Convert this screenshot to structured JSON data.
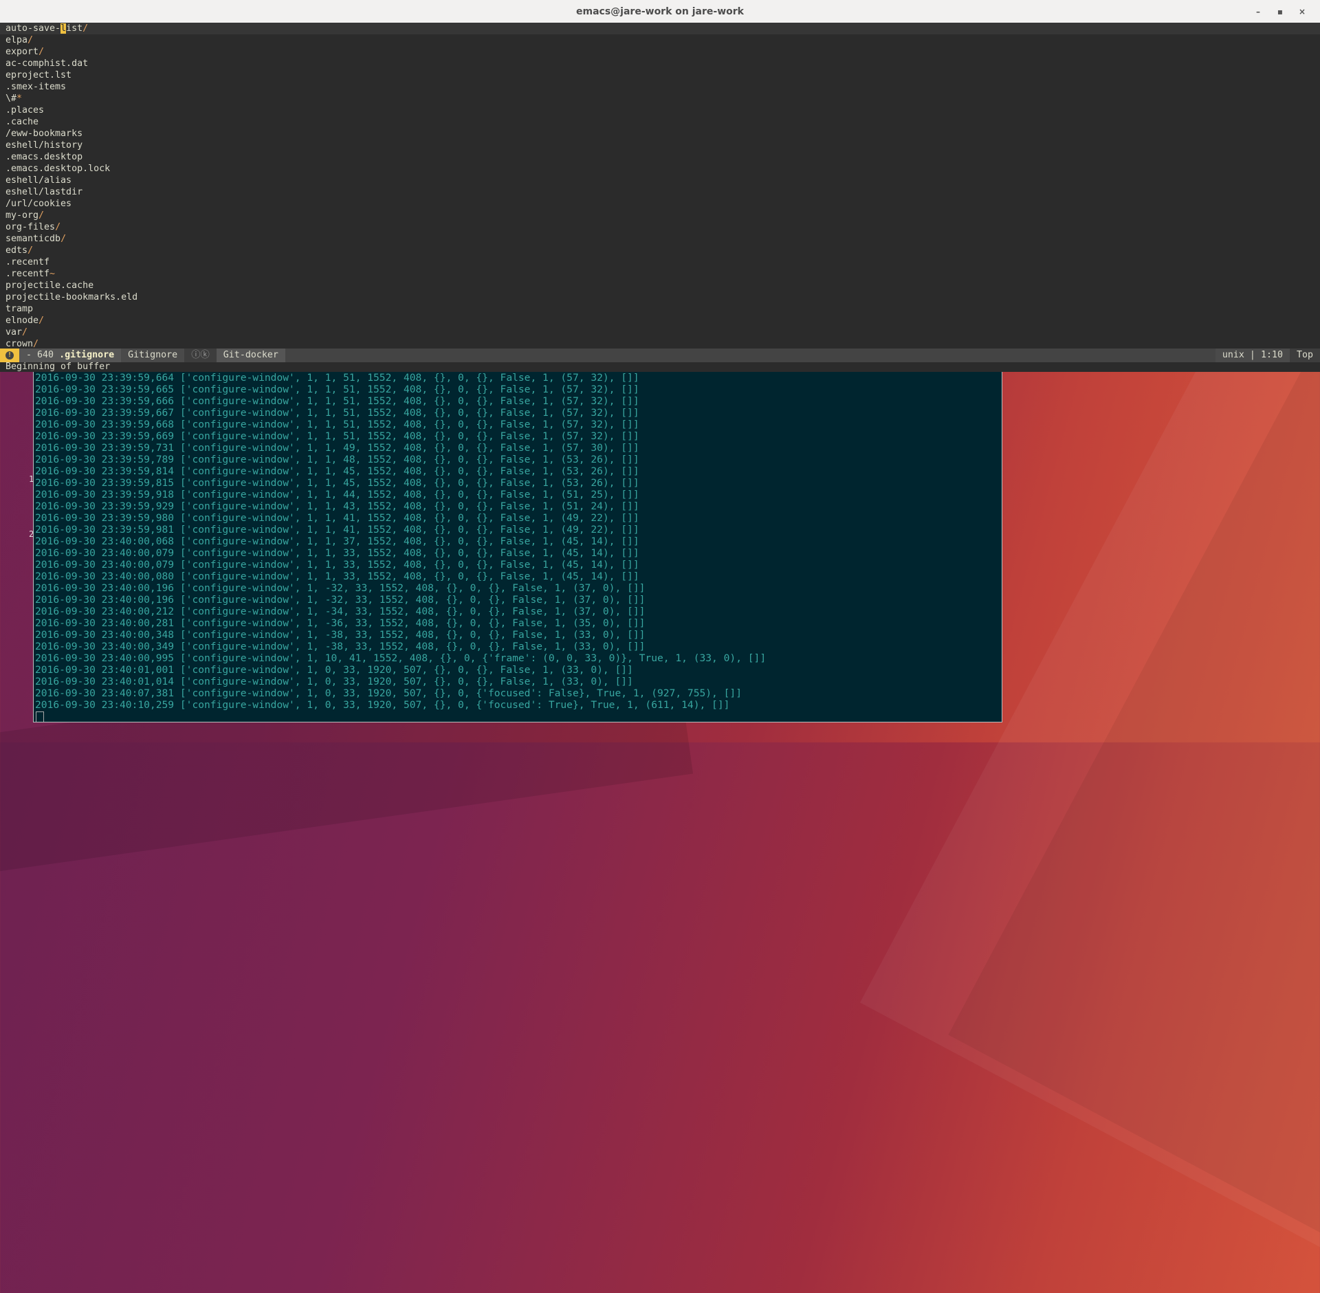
{
  "window": {
    "title": "emacs@jare-work on jare-work",
    "controls": [
      "–",
      "▪",
      "×"
    ]
  },
  "editor": {
    "lines": [
      {
        "name": "auto-save-",
        "cursor": "l",
        "rest": "ist",
        "slash": "/"
      },
      {
        "name": "elpa",
        "slash": "/"
      },
      {
        "name": "export",
        "slash": "/"
      },
      {
        "name": "ac-comphist.dat",
        "slash": ""
      },
      {
        "name": "eproject.lst",
        "slash": ""
      },
      {
        "name": ".smex-items",
        "slash": ""
      },
      {
        "name": "\\#",
        "slash": "*"
      },
      {
        "name": ".places",
        "slash": ""
      },
      {
        "name": ".cache",
        "slash": ""
      },
      {
        "name": "/eww-bookmarks",
        "slash": ""
      },
      {
        "name": "eshell/history",
        "slash": ""
      },
      {
        "name": ".emacs.desktop",
        "slash": ""
      },
      {
        "name": ".emacs.desktop.lock",
        "slash": ""
      },
      {
        "name": "eshell/alias",
        "slash": ""
      },
      {
        "name": "eshell/lastdir",
        "slash": ""
      },
      {
        "name": "/url/cookies",
        "slash": ""
      },
      {
        "name": "my-org",
        "slash": "/"
      },
      {
        "name": "org-files",
        "slash": "/"
      },
      {
        "name": "semanticdb",
        "slash": "/"
      },
      {
        "name": "edts",
        "slash": "/"
      },
      {
        "name": ".recentf",
        "slash": ""
      },
      {
        "name": ".recentf",
        "slash": "~"
      },
      {
        "name": "projectile.cache",
        "slash": ""
      },
      {
        "name": "projectile-bookmarks.eld",
        "slash": ""
      },
      {
        "name": "tramp",
        "slash": ""
      },
      {
        "name": "elnode",
        "slash": "/"
      },
      {
        "name": "var",
        "slash": "/"
      },
      {
        "name": "crown",
        "slash": "/"
      }
    ]
  },
  "modeline": {
    "state_icon": "!",
    "modified": "-",
    "size": "640",
    "buffer": ".gitignore",
    "major_mode": "Gitignore",
    "extra": "ⓘⓚ",
    "branch": "Git-docker",
    "encoding": "unix",
    "position": "1:10",
    "scroll": "Top"
  },
  "echo_area": "Beginning of buffer",
  "gutter_numbers": [
    "1",
    "2"
  ],
  "terminal": {
    "lines": [
      "2016-09-30 23:39:59,664 ['configure-window', 1, 1, 51, 1552, 408, {}, 0, {}, False, 1, (57, 32), []]",
      "2016-09-30 23:39:59,665 ['configure-window', 1, 1, 51, 1552, 408, {}, 0, {}, False, 1, (57, 32), []]",
      "2016-09-30 23:39:59,666 ['configure-window', 1, 1, 51, 1552, 408, {}, 0, {}, False, 1, (57, 32), []]",
      "2016-09-30 23:39:59,667 ['configure-window', 1, 1, 51, 1552, 408, {}, 0, {}, False, 1, (57, 32), []]",
      "2016-09-30 23:39:59,668 ['configure-window', 1, 1, 51, 1552, 408, {}, 0, {}, False, 1, (57, 32), []]",
      "2016-09-30 23:39:59,669 ['configure-window', 1, 1, 51, 1552, 408, {}, 0, {}, False, 1, (57, 32), []]",
      "2016-09-30 23:39:59,731 ['configure-window', 1, 1, 49, 1552, 408, {}, 0, {}, False, 1, (57, 30), []]",
      "2016-09-30 23:39:59,789 ['configure-window', 1, 1, 48, 1552, 408, {}, 0, {}, False, 1, (53, 26), []]",
      "2016-09-30 23:39:59,814 ['configure-window', 1, 1, 45, 1552, 408, {}, 0, {}, False, 1, (53, 26), []]",
      "2016-09-30 23:39:59,815 ['configure-window', 1, 1, 45, 1552, 408, {}, 0, {}, False, 1, (53, 26), []]",
      "2016-09-30 23:39:59,918 ['configure-window', 1, 1, 44, 1552, 408, {}, 0, {}, False, 1, (51, 25), []]",
      "2016-09-30 23:39:59,929 ['configure-window', 1, 1, 43, 1552, 408, {}, 0, {}, False, 1, (51, 24), []]",
      "2016-09-30 23:39:59,980 ['configure-window', 1, 1, 41, 1552, 408, {}, 0, {}, False, 1, (49, 22), []]",
      "2016-09-30 23:39:59,981 ['configure-window', 1, 1, 41, 1552, 408, {}, 0, {}, False, 1, (49, 22), []]",
      "2016-09-30 23:40:00,068 ['configure-window', 1, 1, 37, 1552, 408, {}, 0, {}, False, 1, (45, 14), []]",
      "2016-09-30 23:40:00,079 ['configure-window', 1, 1, 33, 1552, 408, {}, 0, {}, False, 1, (45, 14), []]",
      "2016-09-30 23:40:00,079 ['configure-window', 1, 1, 33, 1552, 408, {}, 0, {}, False, 1, (45, 14), []]",
      "2016-09-30 23:40:00,080 ['configure-window', 1, 1, 33, 1552, 408, {}, 0, {}, False, 1, (45, 14), []]",
      "2016-09-30 23:40:00,196 ['configure-window', 1, -32, 33, 1552, 408, {}, 0, {}, False, 1, (37, 0), []]",
      "2016-09-30 23:40:00,196 ['configure-window', 1, -32, 33, 1552, 408, {}, 0, {}, False, 1, (37, 0), []]",
      "2016-09-30 23:40:00,212 ['configure-window', 1, -34, 33, 1552, 408, {}, 0, {}, False, 1, (37, 0), []]",
      "2016-09-30 23:40:00,281 ['configure-window', 1, -36, 33, 1552, 408, {}, 0, {}, False, 1, (35, 0), []]",
      "2016-09-30 23:40:00,348 ['configure-window', 1, -38, 33, 1552, 408, {}, 0, {}, False, 1, (33, 0), []]",
      "2016-09-30 23:40:00,349 ['configure-window', 1, -38, 33, 1552, 408, {}, 0, {}, False, 1, (33, 0), []]",
      "2016-09-30 23:40:00,995 ['configure-window', 1, 10, 41, 1552, 408, {}, 0, {'frame': (0, 0, 33, 0)}, True, 1, (33, 0), []]",
      "2016-09-30 23:40:01,001 ['configure-window', 1, 0, 33, 1920, 507, {}, 0, {}, False, 1, (33, 0), []]",
      "2016-09-30 23:40:01,014 ['configure-window', 1, 0, 33, 1920, 507, {}, 0, {}, False, 1, (33, 0), []]",
      "2016-09-30 23:40:07,381 ['configure-window', 1, 0, 33, 1920, 507, {}, 0, {'focused': False}, True, 1, (927, 755), []]",
      "2016-09-30 23:40:10,259 ['configure-window', 1, 0, 33, 1920, 507, {}, 0, {'focused': True}, True, 1, (611, 14), []]"
    ]
  },
  "colors": {
    "editor_bg": "#2b2b2b",
    "editor_fg": "#dcdccc",
    "slash": "#e0a060",
    "cursor": "#f0c040",
    "terminal_bg": "#00252f",
    "terminal_fg": "#38a6a0"
  }
}
